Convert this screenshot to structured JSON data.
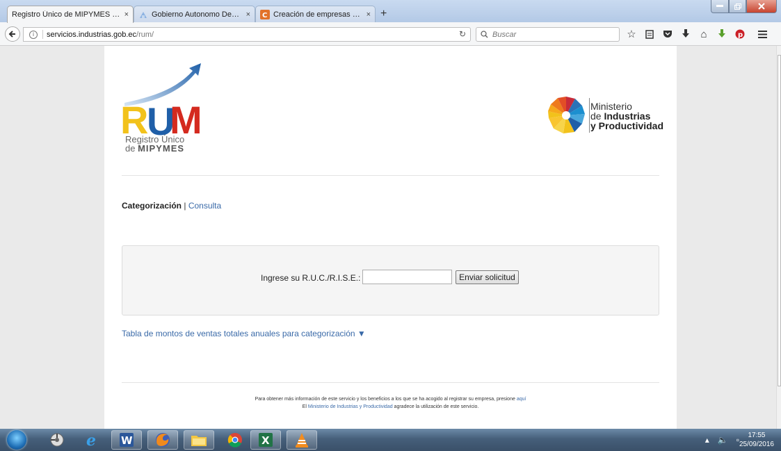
{
  "browser": {
    "tabs": [
      {
        "title": "Registro Único de MIPYMES - R...",
        "icon": "firefox-page-icon",
        "active": true
      },
      {
        "title": "Gobierno Autonomo Desc...",
        "icon": "page-icon",
        "active": false
      },
      {
        "title": "Creación de empresas - Cr...",
        "icon": "orange-c-icon",
        "active": false
      }
    ],
    "close_glyph": "×",
    "new_tab_glyph": "+",
    "url_host": "servicios.industrias.gob.ec",
    "url_path": "/rum/",
    "search_placeholder": "Buscar"
  },
  "page": {
    "logo": {
      "letters": "RUM",
      "line1": "Registro Único",
      "line2_prefix": "de ",
      "line2_bold": "MIPYMES"
    },
    "ministry": {
      "line1": "Ministerio",
      "line2_prefix": "de ",
      "line2_bold": "Industrias",
      "line3": "y Productividad"
    },
    "nav": {
      "current": "Categorización",
      "separator": " | ",
      "link": "Consulta"
    },
    "form": {
      "label": "Ingrese su R.U.C./R.I.S.E.:",
      "input_value": "",
      "button": "Enviar solicitud"
    },
    "tabla_link": "Tabla de montos de ventas totales anuales para categorización ▼",
    "footer": {
      "line1_text": "Para obtener más información de este servicio y los beneficios a los que se ha acogido al registrar su empresa, presione ",
      "line1_link": "aquí",
      "line2_prefix": "El ",
      "line2_link": "Ministerio de Industrias y Productividad",
      "line2_suffix": " agradece la utilización de este servicio."
    }
  },
  "taskbar": {
    "time": "17:55",
    "date": "25/09/2016",
    "apps": [
      "media-center-icon",
      "internet-explorer-icon",
      "word-icon",
      "firefox-icon",
      "file-explorer-icon",
      "chrome-icon",
      "excel-icon",
      "vlc-icon"
    ]
  },
  "colors": {
    "link": "#3a6aa8",
    "rum_blue": "#1f5fa8",
    "rum_red": "#d42a1f",
    "rum_yellow": "#f2c21b"
  }
}
